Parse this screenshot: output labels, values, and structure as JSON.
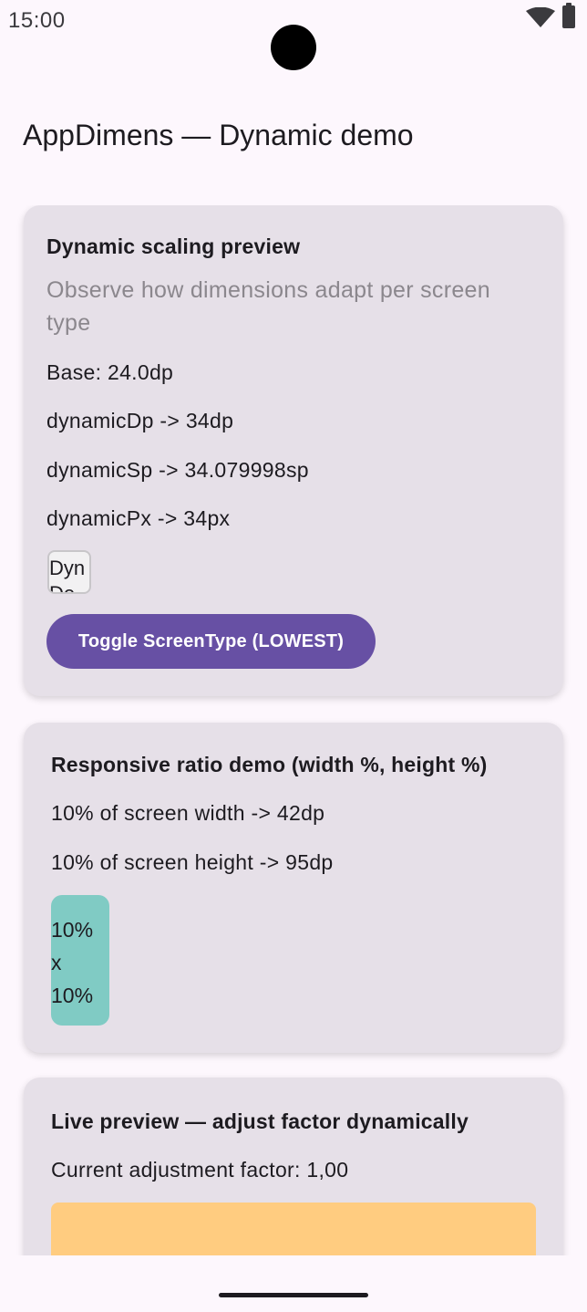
{
  "status_bar": {
    "time": "15:00",
    "wifi_icon": "wifi-icon",
    "battery_icon": "battery-icon"
  },
  "app_bar": {
    "title": "AppDimens — Dynamic demo"
  },
  "cards": {
    "dynamic": {
      "title": "Dynamic scaling preview",
      "subtitle": "Observe how dimensions adapt per screen type",
      "base": "Base: 24.0dp",
      "dp": "dynamicDp -> 34dp",
      "sp": "dynamicSp -> 34.079998sp",
      "px": "dynamicPx -> 34px",
      "sample_text": "Dyn Demo",
      "toggle_label": "Toggle ScreenType (LOWEST)"
    },
    "ratio": {
      "title": "Responsive ratio demo (width %, height %)",
      "width_line": "10% of screen width -> 42dp",
      "height_line": "10% of screen height -> 95dp",
      "box_text": "10% x 10%"
    },
    "live": {
      "title": "Live preview — adjust factor dynamically",
      "factor_line": "Current adjustment factor: 1,00"
    }
  },
  "colors": {
    "background": "#fdf7fd",
    "card": "#e6e0e8",
    "primary": "#6750a4",
    "ratio_box": "#80cbc4",
    "preview_box": "#ffcc80",
    "subtitle": "#8b878d"
  }
}
